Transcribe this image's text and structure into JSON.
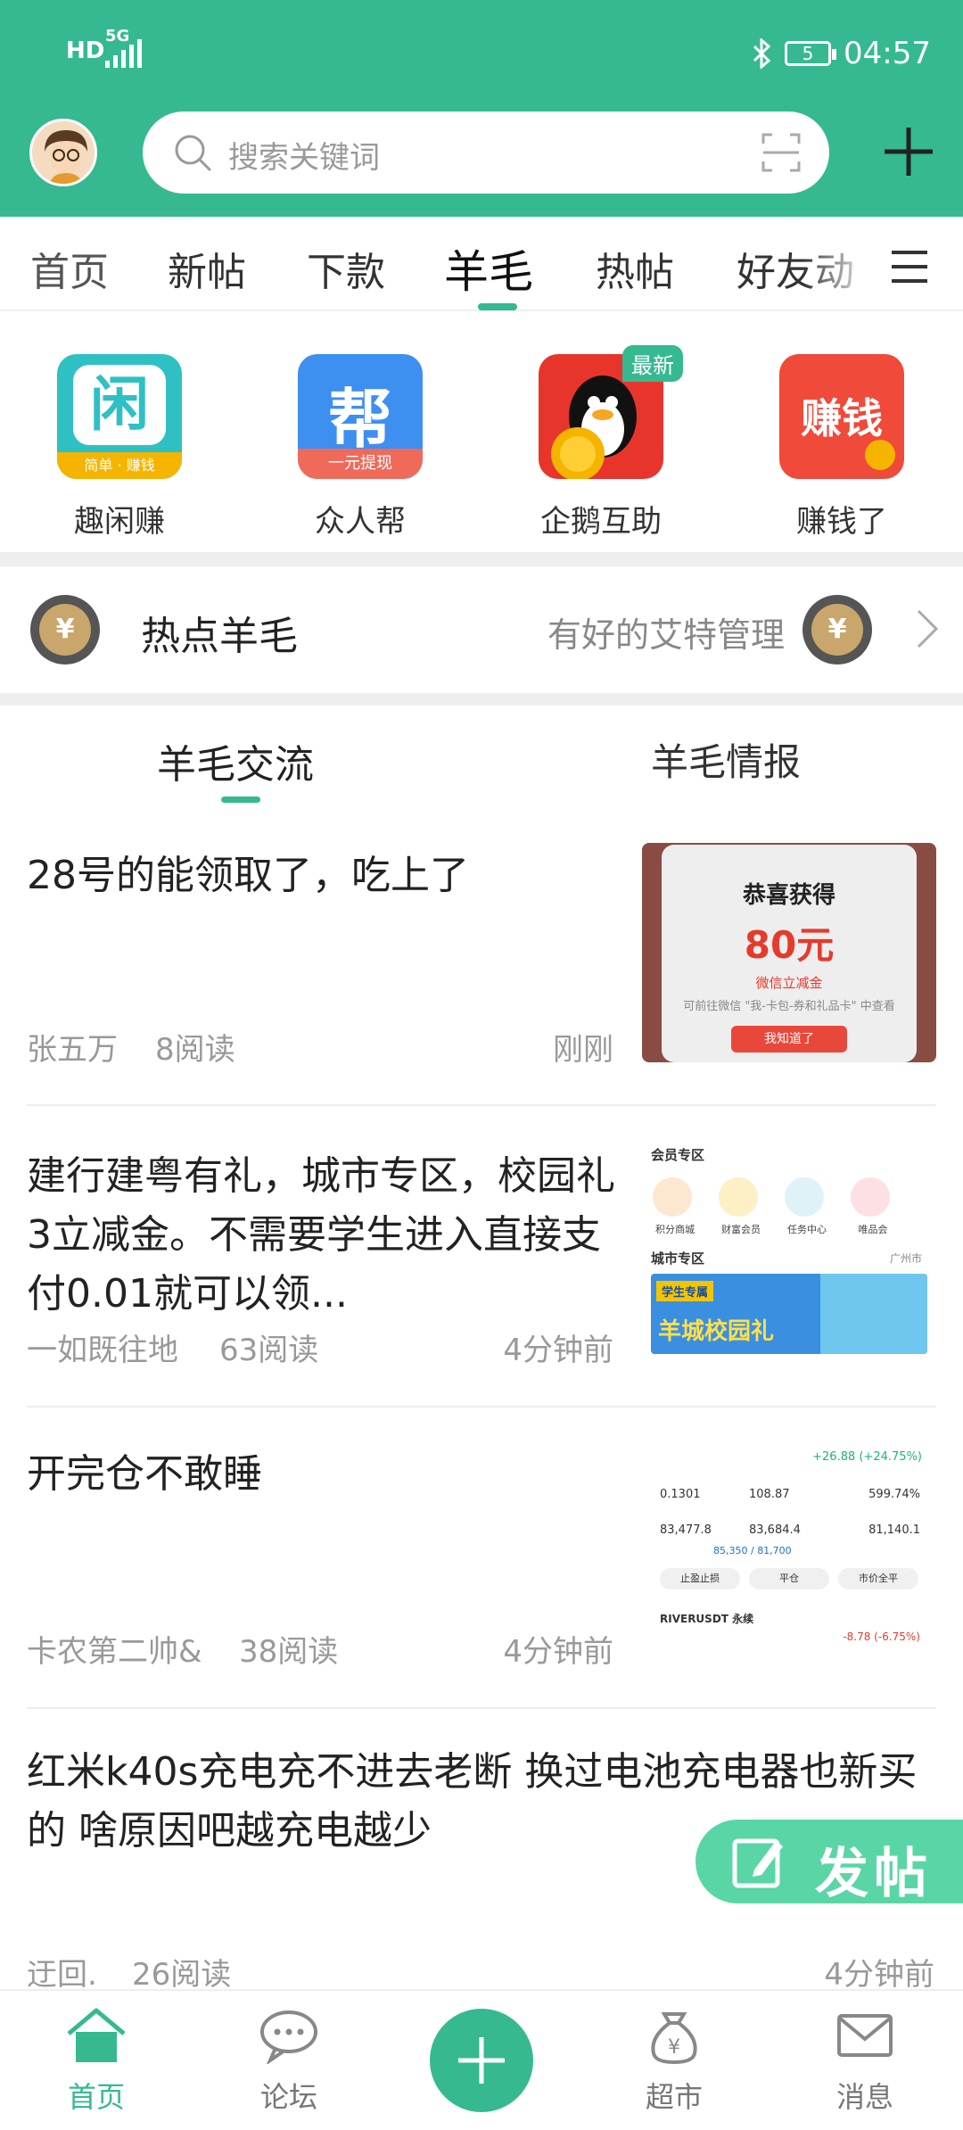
{
  "status_bar": {
    "hd_label": "HD",
    "network_label": "5G",
    "battery_level": "5",
    "time": "04:57"
  },
  "header": {
    "search_placeholder": "搜索关键词"
  },
  "tabs": [
    {
      "label": "首页"
    },
    {
      "label": "新帖"
    },
    {
      "label": "下款"
    },
    {
      "label": "羊毛"
    },
    {
      "label": "热帖"
    },
    {
      "label": "好友动"
    }
  ],
  "shortcuts": [
    {
      "label": "趣闲赚",
      "icon_text": "闲",
      "icon_caption": "简单 · 赚钱"
    },
    {
      "label": "众人帮",
      "icon_text": "帮",
      "icon_caption": "一元提现"
    },
    {
      "label": "企鹅互助",
      "icon_text": "",
      "badge": "最新"
    },
    {
      "label": "赚钱了",
      "icon_text": "赚钱"
    }
  ],
  "hot": {
    "title": "热点羊毛",
    "subtitle": "有好的艾特管理",
    "coin_symbol": "¥"
  },
  "sub_tabs": [
    {
      "label": "羊毛交流"
    },
    {
      "label": "羊毛情报"
    }
  ],
  "posts": [
    {
      "title": "28号的能领取了，吃上了",
      "author": "张五万",
      "reads": "8阅读",
      "time": "刚刚",
      "thumb": {
        "heading": "恭喜获得",
        "amount": "80元",
        "line1": "微信立减金",
        "line2": "可前往微信 \"我-卡包-券和礼品卡\" 中查看",
        "button": "我知道了"
      }
    },
    {
      "title": "建行建粤有礼，城市专区，校园礼3立减金。不需要学生进入直接支付0.01就可以领...",
      "author": "一如既往地",
      "reads": "63阅读",
      "time": "4分钟前",
      "thumb": {
        "section1": "会员专区",
        "items": [
          "积分商城",
          "财富会员",
          "任务中心",
          "唯品会"
        ],
        "section2": "城市专区",
        "city": "广州市",
        "banner_tag": "学生专属",
        "banner_title": "羊城校园礼"
      }
    },
    {
      "title": "开完仓不敢睡",
      "author": "卡农第二帅&",
      "reads": "38阅读",
      "time": "4分钟前",
      "thumb": {
        "change": "+26.88 (+24.75%)",
        "r1": [
          "0.1301",
          "108.87",
          "599.74%"
        ],
        "r2": [
          "83,477.8",
          "83,684.4",
          "81,140.1"
        ],
        "progress": "85,350 / 81,700",
        "buttons": [
          "止盈止损",
          "平仓",
          "市价全平"
        ],
        "symbol": "RIVERUSDT 永续",
        "pnl": "-8.78 (-6.75%)"
      }
    },
    {
      "title": "红米k40s充电充不进去老断 换过电池充电器也新买的 啥原因吧越充电越少",
      "author": "迂回.",
      "reads": "26阅读",
      "time": "4分钟前"
    }
  ],
  "fab": {
    "label": "发帖"
  },
  "bottom_nav": [
    {
      "label": "首页",
      "active": true
    },
    {
      "label": "论坛"
    },
    {
      "label": "超市"
    },
    {
      "label": "消息"
    }
  ],
  "colors": {
    "brand_green": "#36b991",
    "fab_green": "#5ad6a6"
  }
}
